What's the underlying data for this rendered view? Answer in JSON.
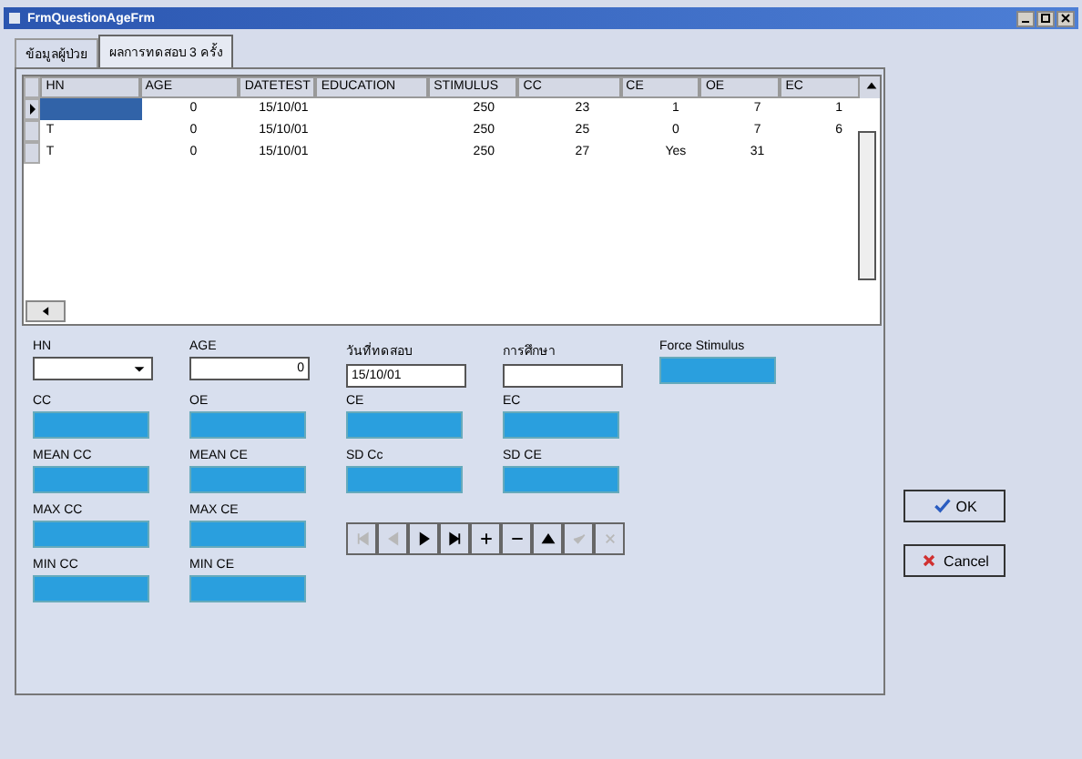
{
  "window": {
    "title": "FrmQuestionAgeFrm"
  },
  "tabs": [
    {
      "label": "ข้อมูลผู้ป่วย",
      "selected": false
    },
    {
      "label": "ผลการทดสอบ 3 ครั้ง",
      "selected": true
    }
  ],
  "table": {
    "columns": [
      "HN",
      "AGE",
      "DATETEST",
      "EDUCATION",
      "STIMULUS",
      "CC",
      "CE",
      "OE",
      "EC"
    ],
    "rows": [
      {
        "current": true,
        "cells": [
          null,
          "0",
          "15/10/01",
          null,
          "250",
          "23",
          "1",
          "7",
          "1"
        ]
      },
      {
        "current": false,
        "cells": [
          "T",
          "0",
          "15/10/01",
          null,
          "250",
          "25",
          "0",
          "7",
          "6"
        ]
      },
      {
        "current": false,
        "cells": [
          "T",
          "0",
          "15/10/01",
          null,
          "250",
          "27",
          "Yes",
          "31",
          null
        ]
      }
    ]
  },
  "form": {
    "inputs": [
      {
        "kind": "combo",
        "label": "HN"
      },
      {
        "kind": "number",
        "label": "AGE",
        "value": "0"
      },
      {
        "kind": "text",
        "label": "วันที่ทดสอบ",
        "value": "15/10/01"
      },
      {
        "kind": "text",
        "label": "การศึกษา"
      },
      {
        "kind": "output",
        "label": "Force Stimulus"
      }
    ],
    "outputs": [
      {
        "label": "CC"
      },
      {
        "label": "OE"
      },
      {
        "label": "CE"
      },
      {
        "label": "EC"
      },
      {
        "label": "MEAN CC"
      },
      {
        "label": "MEAN CE"
      },
      {
        "label": "SD Cc"
      },
      {
        "label": "SD CE"
      }
    ],
    "extra": [
      {
        "label": "MAX CC"
      },
      {
        "label": "MAX CE"
      },
      {
        "label": "MIN CC"
      },
      {
        "label": "MIN CE"
      }
    ]
  },
  "navigator": [
    {
      "kind": "first",
      "disabled": true
    },
    {
      "kind": "prior",
      "disabled": true
    },
    {
      "kind": "next",
      "disabled": false
    },
    {
      "kind": "last",
      "disabled": false
    },
    {
      "kind": "insert",
      "disabled": false
    },
    {
      "kind": "delete",
      "disabled": false
    },
    {
      "kind": "edit",
      "disabled": false
    },
    {
      "kind": "post",
      "disabled": true
    },
    {
      "kind": "cancel",
      "disabled": true
    }
  ],
  "buttons": [
    {
      "kind": "ok",
      "label": "OK"
    },
    {
      "kind": "cancel",
      "label": "Cancel"
    }
  ]
}
